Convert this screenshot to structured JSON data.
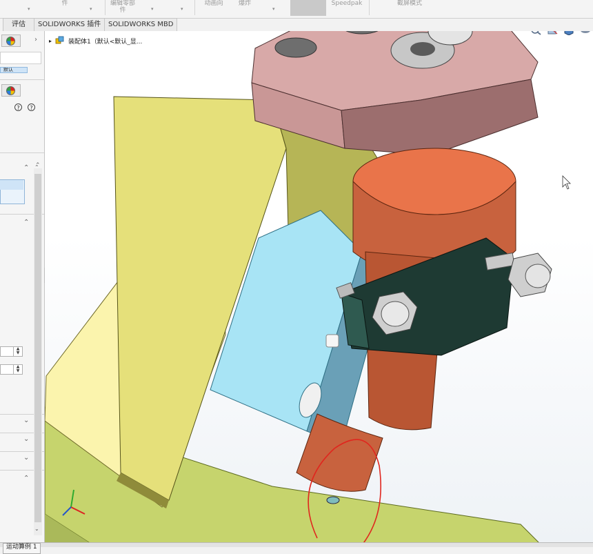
{
  "toolbar": {
    "items": [
      {
        "label": "件"
      },
      {
        "label": "编辑零部件"
      },
      {
        "label": "动画向"
      },
      {
        "label": "爆炸"
      },
      {
        "label": "Speedpak"
      },
      {
        "label": "截屏模式"
      }
    ]
  },
  "tabs": [
    "评估",
    "SOLIDWORKS 插件",
    "SOLIDWORKS MBD"
  ],
  "left_panel": {
    "small_label": "默认"
  },
  "feature_tree": {
    "root_label": "装配体1（默认<默认_显..."
  },
  "status_bar": {
    "tab_label": "运动算例 1"
  },
  "colors": {
    "plate_pink": "#c99796",
    "copper": "#c8623e",
    "light_blue_block": "#a8e4f5",
    "yellow_plate": "#e5e07a",
    "dark_clamp": "#1e3a33",
    "base_plate": "#c6d46d",
    "red_annotation": "#e0261e"
  },
  "icons": [
    "appearance-ball-icon",
    "help-icon",
    "assembly-icon",
    "zoom-icon",
    "section-view-icon",
    "display-style-icon",
    "scene-icon",
    "cursor-icon"
  ]
}
